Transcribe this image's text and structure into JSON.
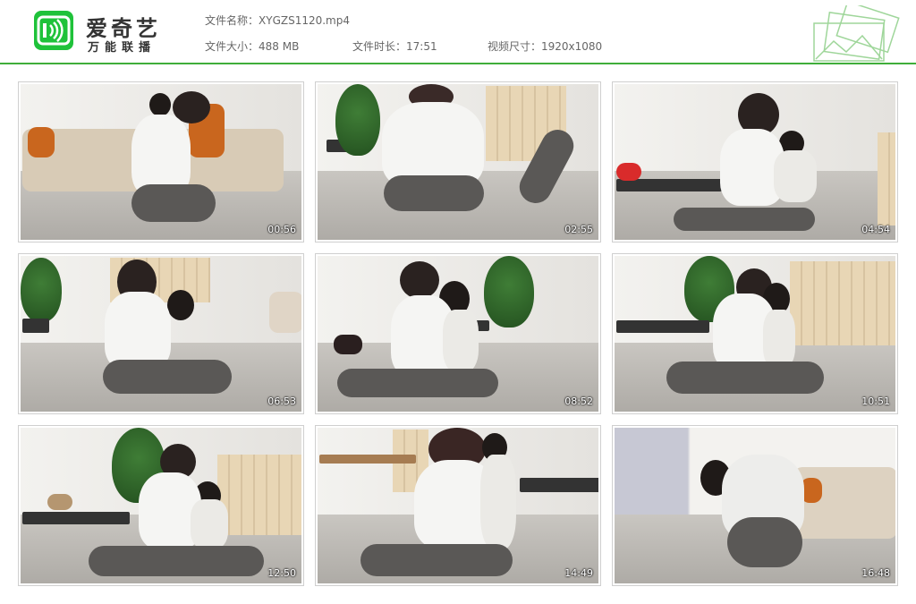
{
  "brand": {
    "name": "爱奇艺",
    "subtitle": "万能联播",
    "logo_color": "#1fc23a"
  },
  "meta": {
    "file_name_label": "文件名称：",
    "file_name": "XYGZS1120.mp4",
    "file_size_label": "文件大小：",
    "file_size": "488 MB",
    "duration_label": "文件时长：",
    "duration": "17:51",
    "resolution_label": "视频尺寸：",
    "resolution": "1920x1080"
  },
  "accent_color": "#3fae3a",
  "thumbnails": [
    {
      "timestamp": "00:56"
    },
    {
      "timestamp": "02:55"
    },
    {
      "timestamp": "04:54"
    },
    {
      "timestamp": "06:53"
    },
    {
      "timestamp": "08:52"
    },
    {
      "timestamp": "10:51"
    },
    {
      "timestamp": "12:50"
    },
    {
      "timestamp": "14:49"
    },
    {
      "timestamp": "16:48"
    }
  ]
}
